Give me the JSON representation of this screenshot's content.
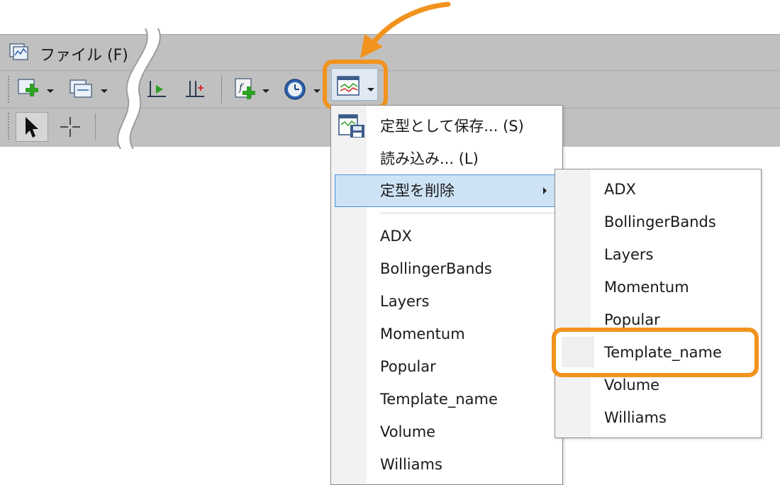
{
  "menubar": {
    "app_icon": "chart-window-icon",
    "file_label": "ファイル (F)"
  },
  "toolbar": {
    "row1_icons": [
      "new-chart-icon",
      "chart-window-icon",
      "autoscroll-icon",
      "chart-shift-icon",
      "indicators-icon",
      "periodicity-clock-icon",
      "template-icon"
    ],
    "row2_icons": [
      "cursor-arrow-icon",
      "crosshair-icon"
    ]
  },
  "template_menu": {
    "items": [
      {
        "label": "定型として保存... (S)",
        "icon": "save-template-icon"
      },
      {
        "label": "読み込み... (L)"
      },
      {
        "label": "定型を削除",
        "has_submenu": true,
        "selected": true
      }
    ],
    "templates": [
      "ADX",
      "BollingerBands",
      "Layers",
      "Momentum",
      "Popular",
      "Template_name",
      "Volume",
      "Williams"
    ]
  },
  "delete_submenu": {
    "templates": [
      "ADX",
      "BollingerBands",
      "Layers",
      "Momentum",
      "Popular",
      "Template_name",
      "Volume",
      "Williams"
    ],
    "highlighted": "Template_name"
  },
  "colors": {
    "highlight": "#f2931e",
    "toolbar_bg": "#c0c0c0",
    "menu_selected_bg": "#cde3f5",
    "menu_selected_border": "#4a90d9"
  }
}
